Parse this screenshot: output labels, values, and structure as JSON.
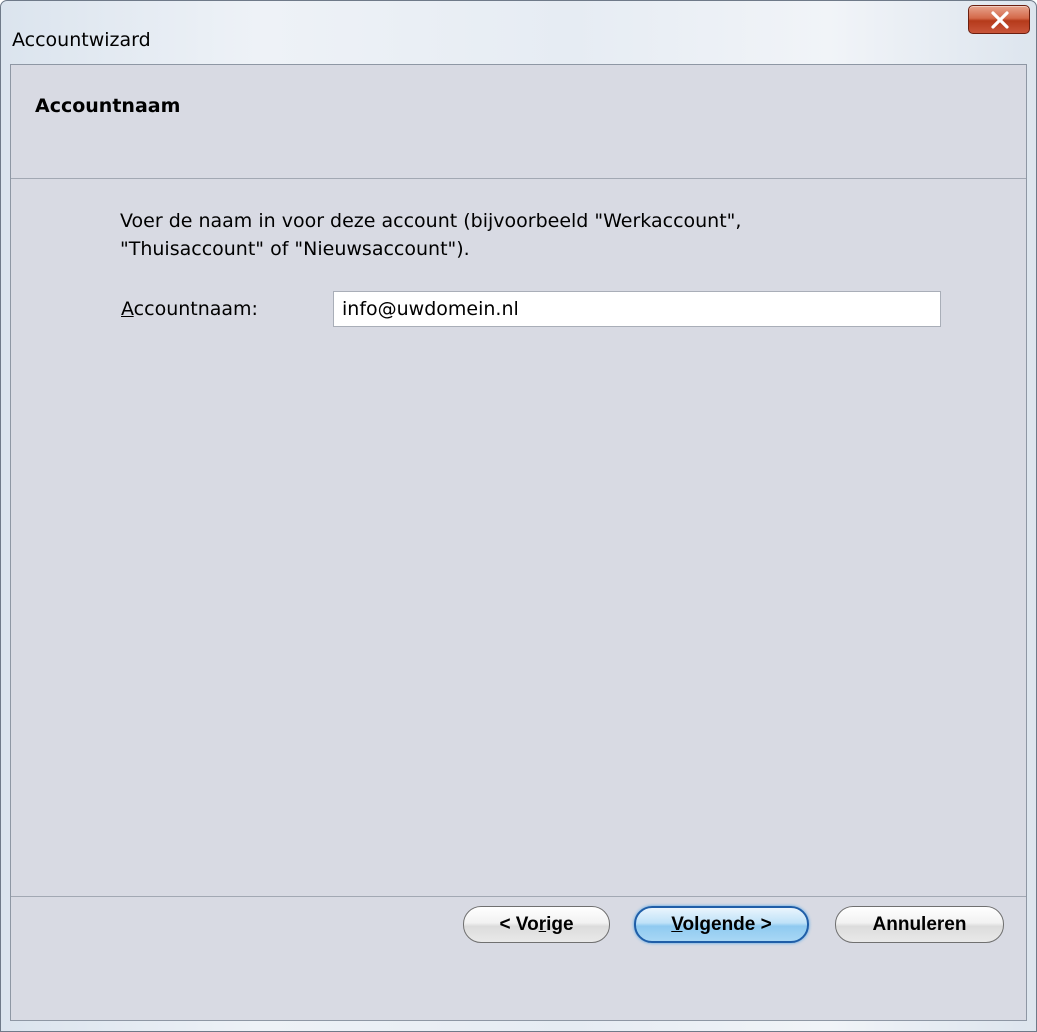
{
  "window": {
    "title": "Accountwizard",
    "close_icon": "close-icon"
  },
  "header": {
    "title": "Accountnaam"
  },
  "main": {
    "instruction_line1": "Voer de naam in voor deze account (bijvoorbeeld \"Werkaccount\",",
    "instruction_line2": "\"Thuisaccount\" of \"Nieuwsaccount\").",
    "field_label_mnemonic": "A",
    "field_label_rest": "ccountnaam:",
    "field_value": "info@uwdomein.nl"
  },
  "buttons": {
    "back_prefix": "< Vo",
    "back_mnemonic": "r",
    "back_suffix": "ige",
    "next_mnemonic": "V",
    "next_suffix": "olgende >",
    "cancel": "Annuleren"
  },
  "colors": {
    "dialog_bg": "#d8dae3",
    "close_button": "#c9553a",
    "default_button_accent": "#8fcaf0"
  }
}
